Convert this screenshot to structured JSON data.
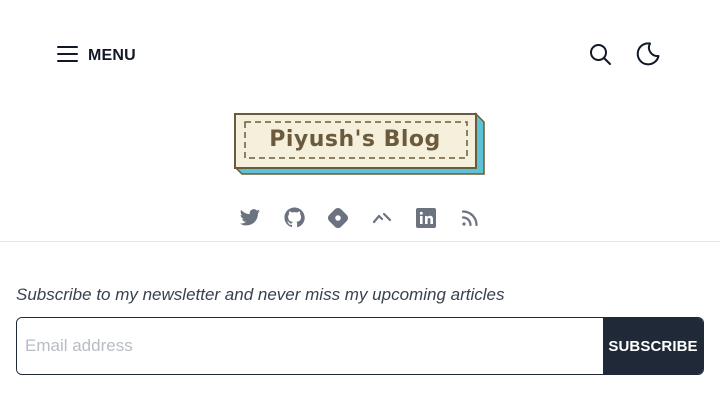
{
  "header": {
    "menu_label": "MENU",
    "menu_icon": "hamburger-icon",
    "search_icon": "search-icon",
    "theme_icon": "moon-icon"
  },
  "logo": {
    "text": "Piyush's Blog",
    "colors": {
      "fill": "#f5f0dc",
      "text": "#6b5a3b",
      "border": "#6b5a3b",
      "shadow": "#5cc3d6"
    }
  },
  "social": {
    "items": [
      {
        "icon": "twitter-icon"
      },
      {
        "icon": "github-icon"
      },
      {
        "icon": "hashnode-icon"
      },
      {
        "icon": "devto-icon"
      },
      {
        "icon": "linkedin-icon"
      },
      {
        "icon": "rss-icon"
      }
    ],
    "icon_color": "#6b7280"
  },
  "newsletter": {
    "text": "Subscribe to my newsletter and never miss my upcoming articles",
    "email_placeholder": "Email address",
    "email_value": "",
    "subscribe_label": "SUBSCRIBE",
    "button_color": "#1f2937"
  }
}
